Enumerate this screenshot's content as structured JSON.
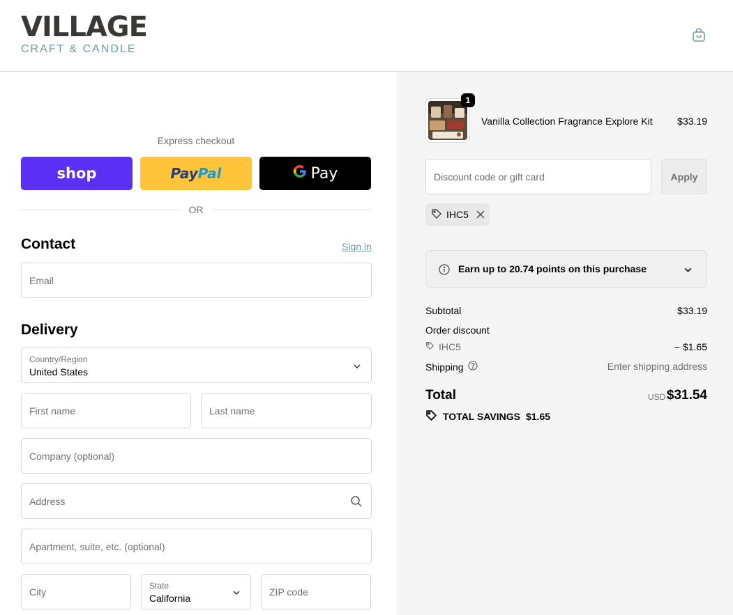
{
  "header": {
    "logo_main": "VILLAGE",
    "logo_sub": "CRAFT & CANDLE",
    "cart_icon": "shopping-bag-icon"
  },
  "express": {
    "title": "Express checkout",
    "shop_label": "shop",
    "paypal_label_a": "Pay",
    "paypal_label_b": "Pal",
    "gpay_label": "Pay",
    "or_label": "OR"
  },
  "contact": {
    "title": "Contact",
    "signin_label": "Sign in",
    "email_placeholder": "Email"
  },
  "delivery": {
    "title": "Delivery",
    "country_label": "Country/Region",
    "country_value": "United States",
    "first_name_placeholder": "First name",
    "last_name_placeholder": "Last name",
    "company_placeholder": "Company (optional)",
    "address_placeholder": "Address",
    "apartment_placeholder": "Apartment, suite, etc. (optional)",
    "city_placeholder": "City",
    "state_label": "State",
    "state_value": "California",
    "zip_placeholder": "ZIP code"
  },
  "order": {
    "item_qty": "1",
    "item_name": "Vanilla Collection Fragrance Explore Kit",
    "item_price": "$33.19",
    "discount_placeholder": "Discount code or gift card",
    "apply_label": "Apply",
    "applied_code": "IHC5",
    "points_text": "Earn up to 20.74 points on this purchase",
    "subtotal_label": "Subtotal",
    "subtotal_value": "$33.19",
    "order_discount_label": "Order discount",
    "discount_code": "IHC5",
    "discount_value": "− $1.65",
    "shipping_label": "Shipping",
    "shipping_value": "Enter shipping address",
    "total_label": "Total",
    "total_currency": "USD",
    "total_value": "$31.54",
    "savings_label": "TOTAL SAVINGS",
    "savings_value": "$1.65"
  },
  "colors": {
    "accent": "#6f9aa0",
    "shop_purple": "#5a31f4",
    "paypal_yellow": "#ffc439",
    "summary_bg": "#f5f5f5"
  }
}
